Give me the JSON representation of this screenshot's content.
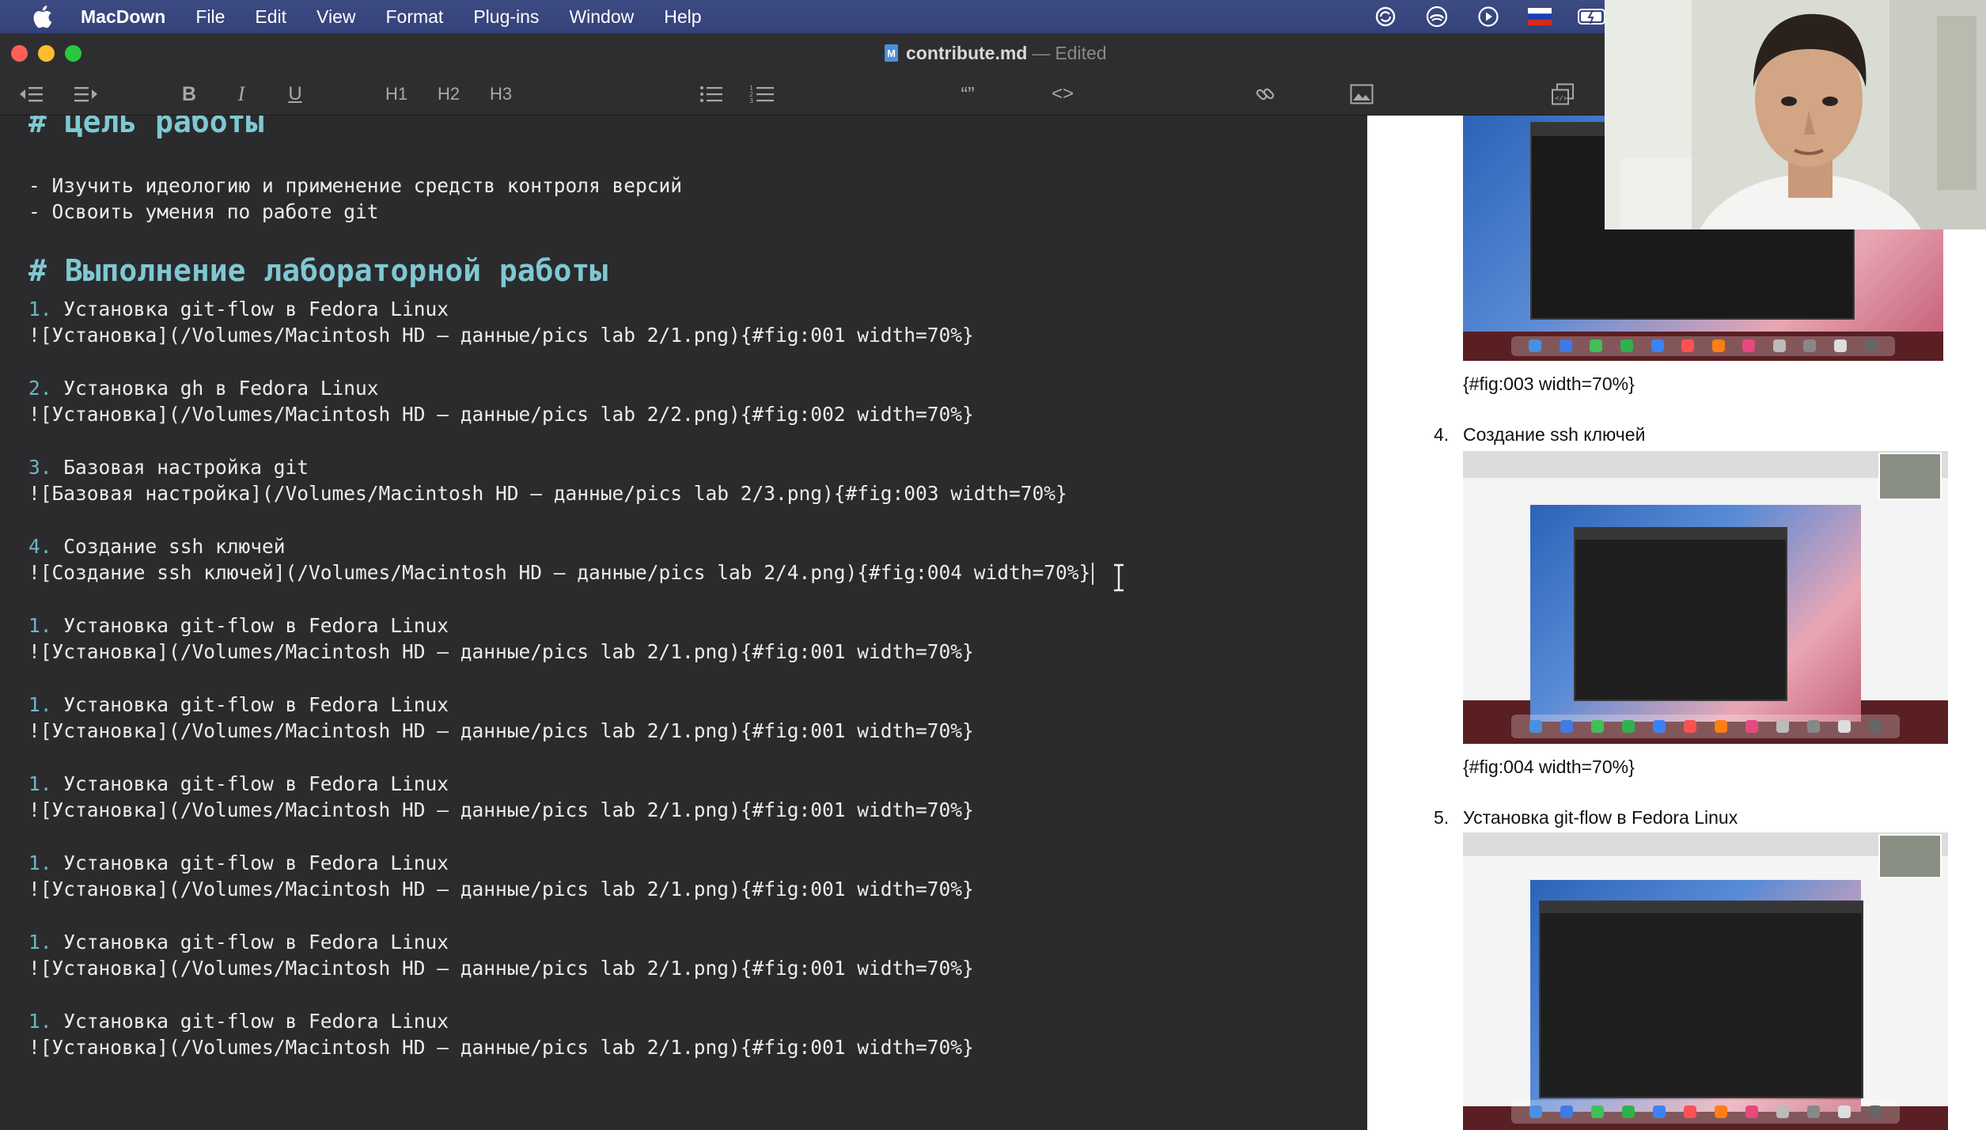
{
  "menubar": {
    "app_name": "MacDown",
    "menus": [
      "File",
      "Edit",
      "View",
      "Format",
      "Plug-ins",
      "Window",
      "Help"
    ],
    "status_icons": [
      "sync-icon",
      "cloud-icon",
      "play-icon",
      "flag-icon",
      "battery-icon"
    ]
  },
  "window": {
    "filename": "contribute.md",
    "separator": "—",
    "state": "Edited"
  },
  "toolbar": {
    "bold": "B",
    "italic": "I",
    "underline": "U",
    "h1": "H1",
    "h2": "H2",
    "h3": "H3",
    "quote": "“”",
    "code": "<>"
  },
  "editor": {
    "lines": [
      {
        "kind": "h1",
        "text": "# Цель работы"
      },
      {
        "kind": "p",
        "text": "- Изучить идеологию и применение средств контроля версий"
      },
      {
        "kind": "p",
        "text": "- Освоить умения по работе git"
      },
      {
        "kind": "h1",
        "text": "# Выполнение лабораторной работы"
      },
      {
        "kind": "li",
        "num": "1.",
        "text": " Установка git-flow в Fedora Linux"
      },
      {
        "kind": "p",
        "text": "![Установка](/Volumes/Macintosh HD — данные/pics lab 2/1.png){#fig:001 width=70%}"
      },
      {
        "kind": "li",
        "num": "2.",
        "text": " Установка gh в Fedora Linux"
      },
      {
        "kind": "p",
        "text": "![Установка](/Volumes/Macintosh HD — данные/pics lab 2/2.png){#fig:002 width=70%}"
      },
      {
        "kind": "li",
        "num": "3.",
        "text": " Базовая настройка git"
      },
      {
        "kind": "p",
        "text": "![Базовая настройка](/Volumes/Macintosh HD — данные/pics lab 2/3.png){#fig:003 width=70%}"
      },
      {
        "kind": "li",
        "num": "4.",
        "text": " Создание ssh ключей"
      },
      {
        "kind": "p",
        "text": "![Создание ssh ключей](/Volumes/Macintosh HD — данные/pics lab 2/4.png){#fig:004 width=70%}"
      },
      {
        "kind": "li",
        "num": "1.",
        "text": " Установка git-flow в Fedora Linux"
      },
      {
        "kind": "p",
        "text": "![Установка](/Volumes/Macintosh HD — данные/pics lab 2/1.png){#fig:001 width=70%}"
      },
      {
        "kind": "li",
        "num": "1.",
        "text": " Установка git-flow в Fedora Linux"
      },
      {
        "kind": "p",
        "text": "![Установка](/Volumes/Macintosh HD — данные/pics lab 2/1.png){#fig:001 width=70%}"
      },
      {
        "kind": "li",
        "num": "1.",
        "text": " Установка git-flow в Fedora Linux"
      },
      {
        "kind": "p",
        "text": "![Установка](/Volumes/Macintosh HD — данные/pics lab 2/1.png){#fig:001 width=70%}"
      },
      {
        "kind": "li",
        "num": "1.",
        "text": " Установка git-flow в Fedora Linux"
      },
      {
        "kind": "p",
        "text": "![Установка](/Volumes/Macintosh HD — данные/pics lab 2/1.png){#fig:001 width=70%}"
      },
      {
        "kind": "li",
        "num": "1.",
        "text": " Установка git-flow в Fedora Linux"
      },
      {
        "kind": "p",
        "text": "![Установка](/Volumes/Macintosh HD — данные/pics lab 2/1.png){#fig:001 width=70%}"
      },
      {
        "kind": "li",
        "num": "1.",
        "text": " Установка git-flow в Fedora Linux"
      },
      {
        "kind": "p",
        "text": "![Установка](/Volumes/Macintosh HD — данные/pics lab 2/1.png){#fig:001 width=70%}"
      }
    ]
  },
  "preview": {
    "caption_3": "{#fig:003 width=70%}",
    "item_4_num": "4.",
    "item_4_text": "Создание ssh ключей",
    "caption_4": "{#fig:004 width=70%}",
    "item_5_num": "5.",
    "item_5_text": "Установка git-flow в Fedora Linux"
  }
}
